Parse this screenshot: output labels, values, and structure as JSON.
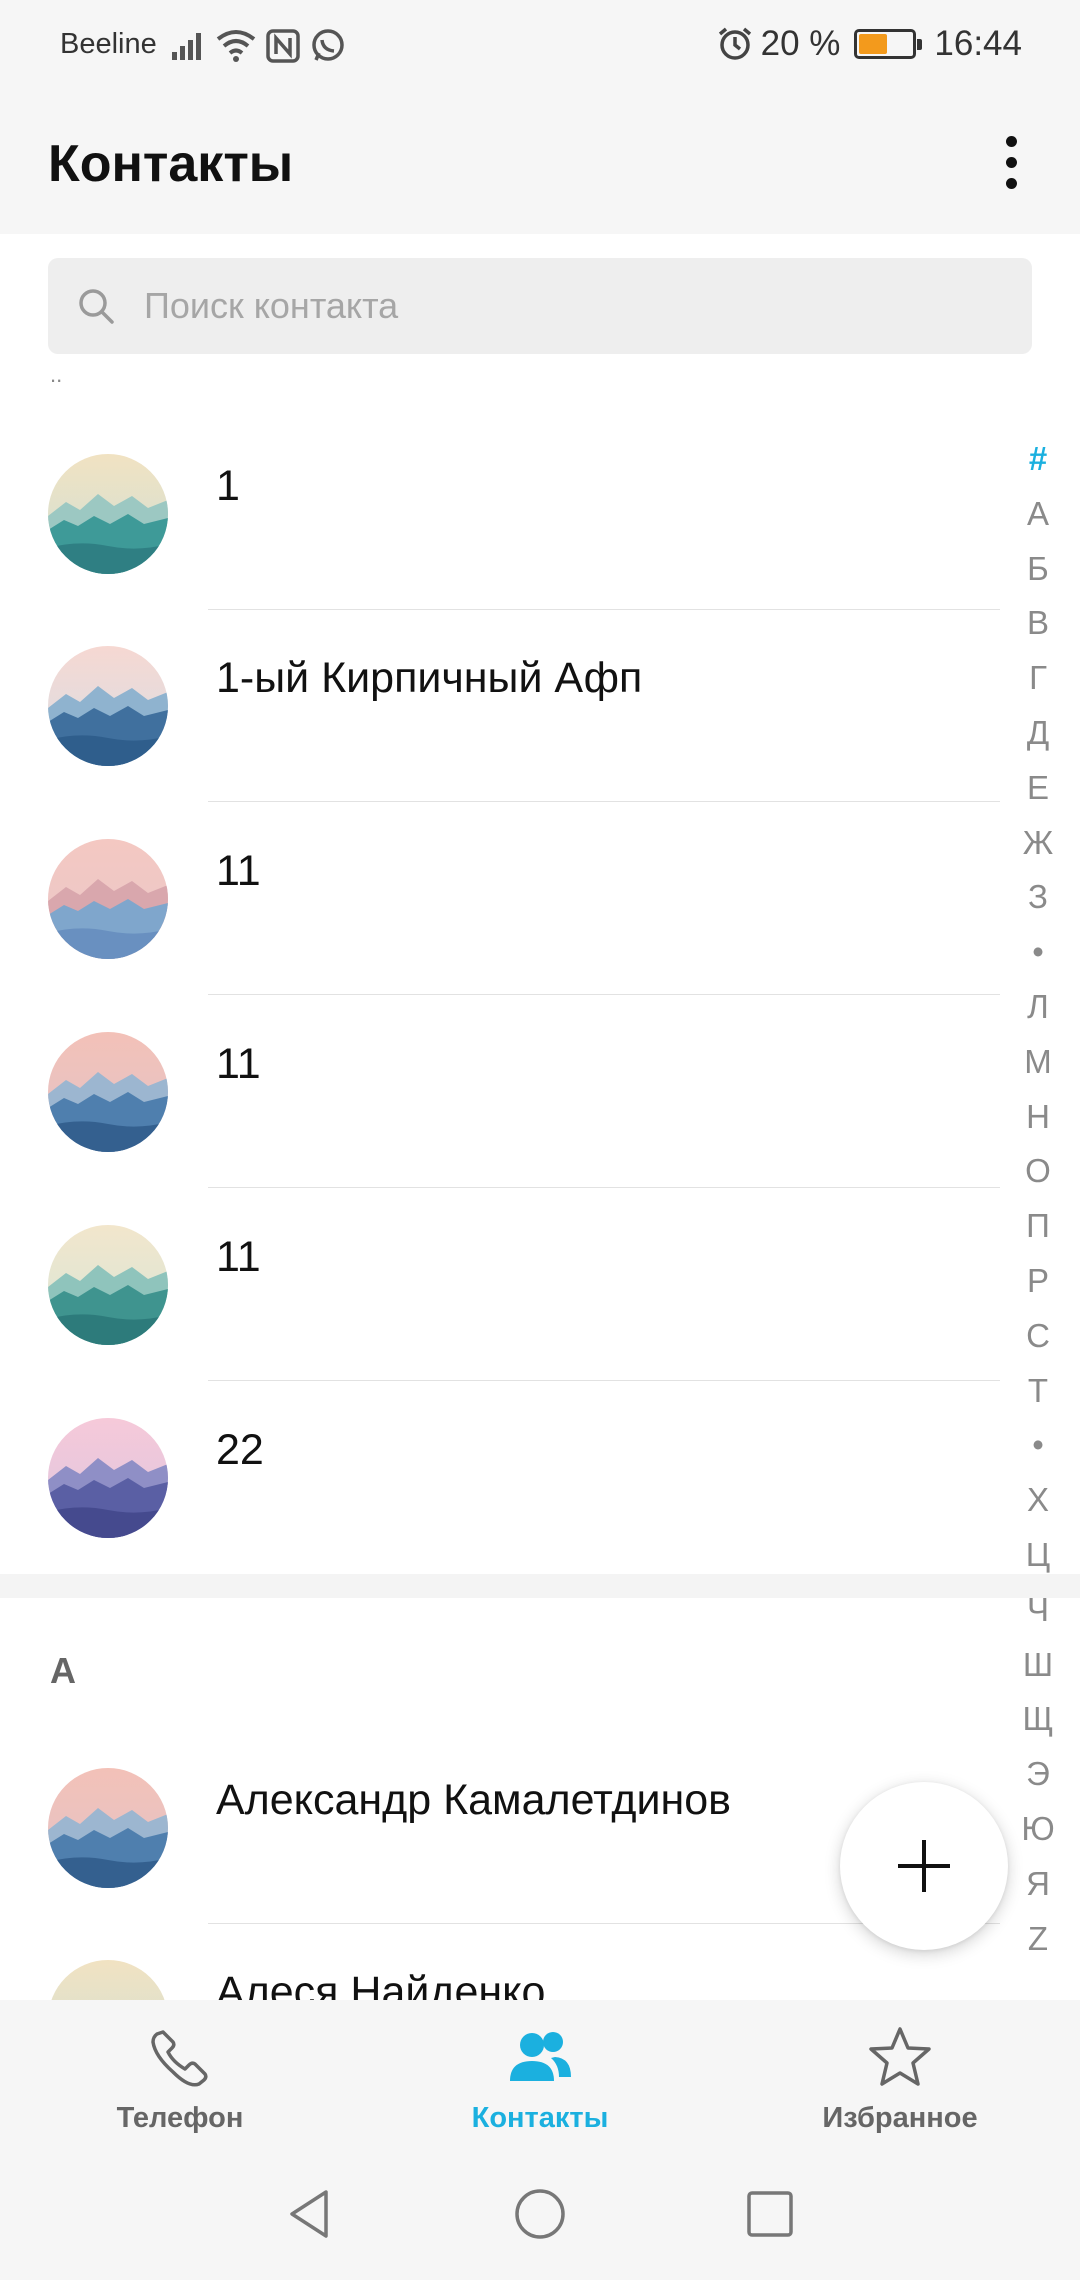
{
  "status_bar": {
    "carrier": "Beeline",
    "battery_percent": "20 %",
    "battery_level": 0.2,
    "time": "16:44",
    "icons": [
      "signal-icon",
      "wifi-icon",
      "nfc-icon",
      "whatsapp-icon",
      "alarm-icon",
      "battery-icon"
    ]
  },
  "app_bar": {
    "title": "Контакты",
    "more_icon": "more-vertical-icon"
  },
  "search": {
    "placeholder": "Поиск контакта",
    "icon": "search-icon"
  },
  "top_mark": "..",
  "sections": [
    {
      "header": "",
      "contacts": [
        {
          "name": "1",
          "avatar": "teal-mountains"
        },
        {
          "name": "1-ый Кирпичный Афп",
          "avatar": "blue-forest"
        },
        {
          "name": "11",
          "avatar": "pink-lake"
        },
        {
          "name": "11",
          "avatar": "pink-blue-mountains"
        },
        {
          "name": "11",
          "avatar": "teal-forest"
        },
        {
          "name": "22",
          "avatar": "purple-forest"
        }
      ]
    },
    {
      "header": "А",
      "contacts": [
        {
          "name": "Александр Камалетдинов",
          "avatar": "pink-blue-mountains"
        },
        {
          "name": "Алеся Найденко",
          "avatar": "teal-mountains"
        }
      ]
    }
  ],
  "index_bar": [
    "#",
    "А",
    "Б",
    "В",
    "Г",
    "Д",
    "Е",
    "Ж",
    "З",
    "•",
    "Л",
    "М",
    "Н",
    "О",
    "П",
    "Р",
    "С",
    "Т",
    "•",
    "Х",
    "Ц",
    "Ч",
    "Ш",
    "Щ",
    "Э",
    "Ю",
    "Я",
    "Z"
  ],
  "index_active": "#",
  "fab": {
    "icon": "plus-icon"
  },
  "bottom_nav": [
    {
      "label": "Телефон",
      "icon": "phone-icon",
      "active": false
    },
    {
      "label": "Контакты",
      "icon": "contacts-icon",
      "active": true
    },
    {
      "label": "Избранное",
      "icon": "star-icon",
      "active": false
    }
  ],
  "colors": {
    "accent": "#1bb0df",
    "background": "#ffffff",
    "bar_background": "#f6f6f6"
  }
}
